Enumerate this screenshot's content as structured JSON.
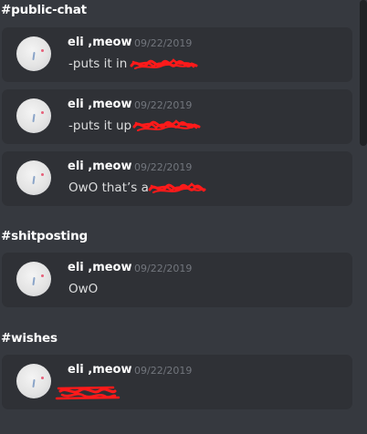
{
  "channels": [
    {
      "name": "#public-chat",
      "messages": [
        {
          "user": "eli ,meow",
          "time": "09/22/2019",
          "text": "-puts it in"
        },
        {
          "user": "eli ,meow",
          "time": "09/22/2019",
          "text": "-puts it up"
        },
        {
          "user": "eli ,meow",
          "time": "09/22/2019",
          "text": "OwO that’s a"
        }
      ]
    },
    {
      "name": "#shitposting",
      "messages": [
        {
          "user": "eli ,meow",
          "time": "09/22/2019",
          "text": "OwO"
        }
      ]
    },
    {
      "name": "#wishes",
      "messages": [
        {
          "user": "eli ,meow",
          "time": "09/22/2019",
          "text": ""
        }
      ]
    }
  ],
  "icons": {
    "avatar": "avatar-icon",
    "redaction": "red-scribble-redaction"
  },
  "colors": {
    "background": "#36393f",
    "card": "#2f3136",
    "username": "#ffffff",
    "timestamp": "#72767d",
    "message_text": "#dcddde",
    "redaction": "#ff1a1a"
  }
}
